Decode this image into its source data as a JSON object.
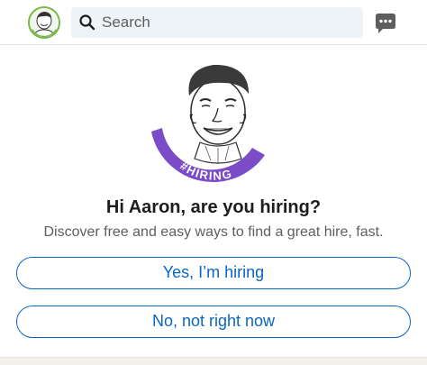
{
  "header": {
    "search": {
      "placeholder": "Search"
    },
    "icons": {
      "avatar": "profile-photo",
      "search": "magnifier-icon",
      "messaging": "chat-bubble-icon"
    }
  },
  "promo": {
    "badge_text": "#HIRING",
    "title": "Hi Aaron, are you hiring?",
    "subtitle": "Discover free and easy ways to find a great hire, fast.",
    "primary_button": "Yes, I’m hiring",
    "secondary_button": "No, not right now"
  },
  "colors": {
    "accent": "#0a66c2",
    "hiring_frame": "#7b4bc8",
    "search_bg": "#eef3f8"
  }
}
